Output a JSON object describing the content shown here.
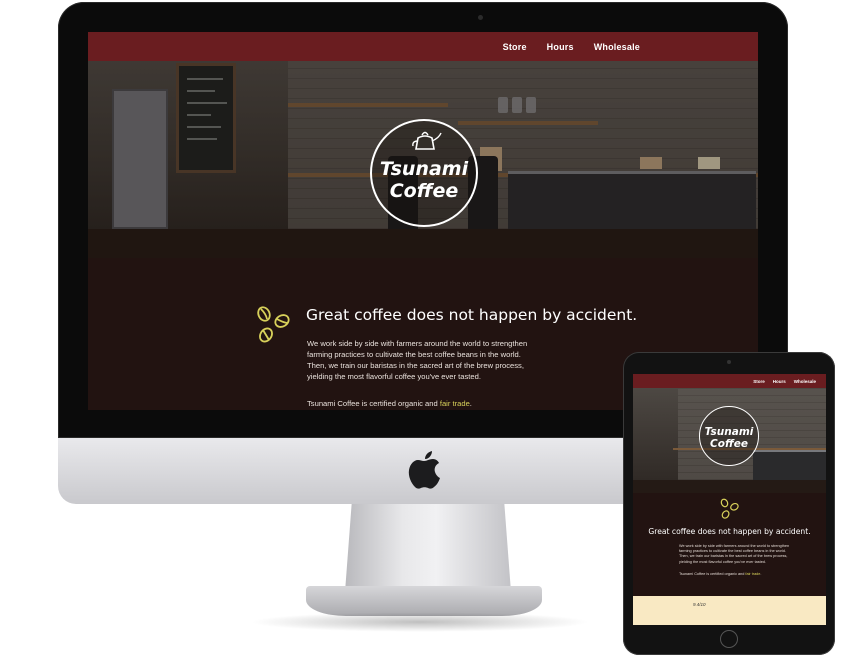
{
  "site": {
    "nav": [
      "Store",
      "Hours",
      "Wholesale"
    ],
    "logo_line1": "Tsunami",
    "logo_line2": "Coffee",
    "headline": "Great coffee does not happen by accident.",
    "body": "We work side by side with farmers around the world to strengthen farming practices to cultivate the best coffee beans in the world. Then, we train our baristas in the sacred art of the brew process, yielding the most flavorful coffee you've ever tasted.",
    "certified_prefix": "Tsunami Coffee is certified organic and ",
    "certified_link": "fair trade",
    "certified_suffix": ".",
    "tablet_scribble": "9.4/10"
  },
  "colors": {
    "nav_bg": "#6a1d20",
    "page_bg": "#221311",
    "link_accent": "#d7d05a",
    "bean_icon": "#d7d05a",
    "tablet_footer_bg": "#f9e9c3"
  },
  "icons": {
    "computer_brand": "apple-logo-icon",
    "beans": "coffee-beans-icon",
    "kettle": "kettle-icon"
  }
}
